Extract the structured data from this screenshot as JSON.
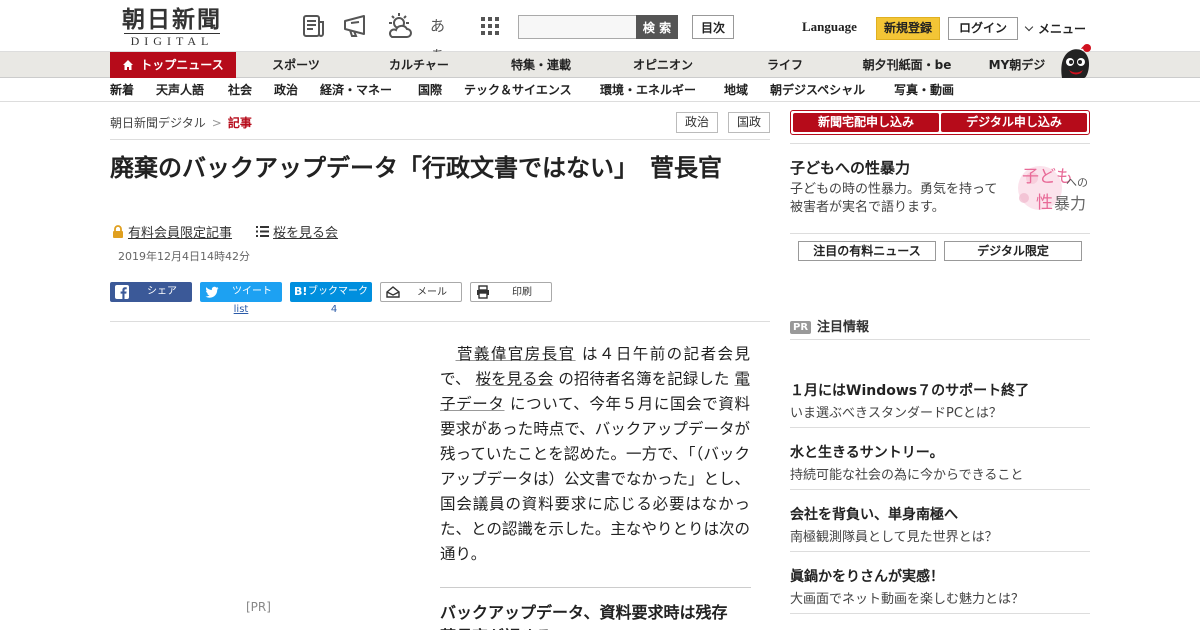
{
  "header": {
    "logo_kanji": "朝日新聞",
    "logo_latin": "DIGITAL",
    "icons": [
      "newspaper-icon",
      "megaphone-icon",
      "weather-icon",
      "font-size-icon",
      "apps-grid-icon"
    ],
    "font_size_glyph": "あぁ",
    "search_button": "検 索",
    "toc_button": "目次",
    "language": "Language",
    "register": "新規登録",
    "login": "ログイン",
    "menu": "メニュー"
  },
  "primary_nav": {
    "top_news": "トップニュース",
    "items": [
      "スポーツ",
      "カルチャー",
      "特集・連載",
      "オピニオン",
      "ライフ",
      "朝夕刊紙面・be",
      "MY朝デジ"
    ]
  },
  "secondary_nav": {
    "items": [
      "新着",
      "天声人語",
      "社会",
      "政治",
      "経済・マネー",
      "国際",
      "テック＆サイエンス",
      "環境・エネルギー",
      "地域",
      "朝デジスペシャル",
      "写真・動画"
    ]
  },
  "breadcrumb": {
    "home": "朝日新聞デジタル",
    "separator": ">",
    "current": "記事"
  },
  "tags": [
    "政治",
    "国政"
  ],
  "article": {
    "title": "廃棄のバックアップデータ「行政文書ではない」　菅長官",
    "paid_label": "有料会員限定記事",
    "topic_label": "桜を見る会",
    "date": "2019年12月4日14時42分",
    "share": {
      "facebook": "シェア",
      "twitter": "ツイート",
      "hatena": "ブックマーク",
      "mail": "メール",
      "print": "印刷",
      "twitter_count": "list",
      "hatena_count": "4"
    },
    "body_kw1": "菅義偉官房長官",
    "body_t1": "は４日午前の記者会見で、",
    "body_kw2": "桜を見る会",
    "body_t2": "の招待者名簿を記録した",
    "body_kw3": "電子データ",
    "body_t3": "について、今年５月に国会で資料要求があった時点で、バックアップデータが残っていたことを認めた。一方で、「（バックアップデータは）公文書でなかった」とし、国会議員の資料要求に応じる必要はなかった、との認識を示した。主なやりとりは次の通り。",
    "section_heading": "バックアップデータ、資料要求時は残存　菅長官が認める"
  },
  "left_ad_label": "[PR]",
  "sidebar": {
    "subscribe_newspaper": "新聞宅配申し込み",
    "subscribe_digital": "デジタル申し込み",
    "promo_title": "子どもへの性暴力",
    "promo_text": "子どもの時の性暴力。勇気を持って被害者が実名で語ります。",
    "promo_image_text1": "子ども",
    "promo_image_text2": "への",
    "promo_image_text3": "性",
    "promo_image_text4": "暴力",
    "featured_paid": "注目の有料ニュース",
    "digital_only": "デジタル限定",
    "pr_tag": "PR",
    "pr_heading": "注目情報",
    "ads": [
      {
        "title": "１月にはWindows７のサポート終了",
        "sub": "いま選ぶべきスタンダードPCとは？"
      },
      {
        "title": "水と生きるサントリー。",
        "sub": "持続可能な社会の為に今からできること"
      },
      {
        "title": "会社を背負い、単身南極へ",
        "sub": "南極観測隊員として見た世界とは？"
      },
      {
        "title": "眞鍋かをりさんが実感！",
        "sub": "大画面でネット動画を楽しむ魅力とは？"
      }
    ]
  },
  "colors": {
    "brand_red": "#b60b1a",
    "register_yellow": "#f3c536",
    "facebook": "#3b5998",
    "twitter": "#1da1f2",
    "hatena": "#008fde"
  }
}
